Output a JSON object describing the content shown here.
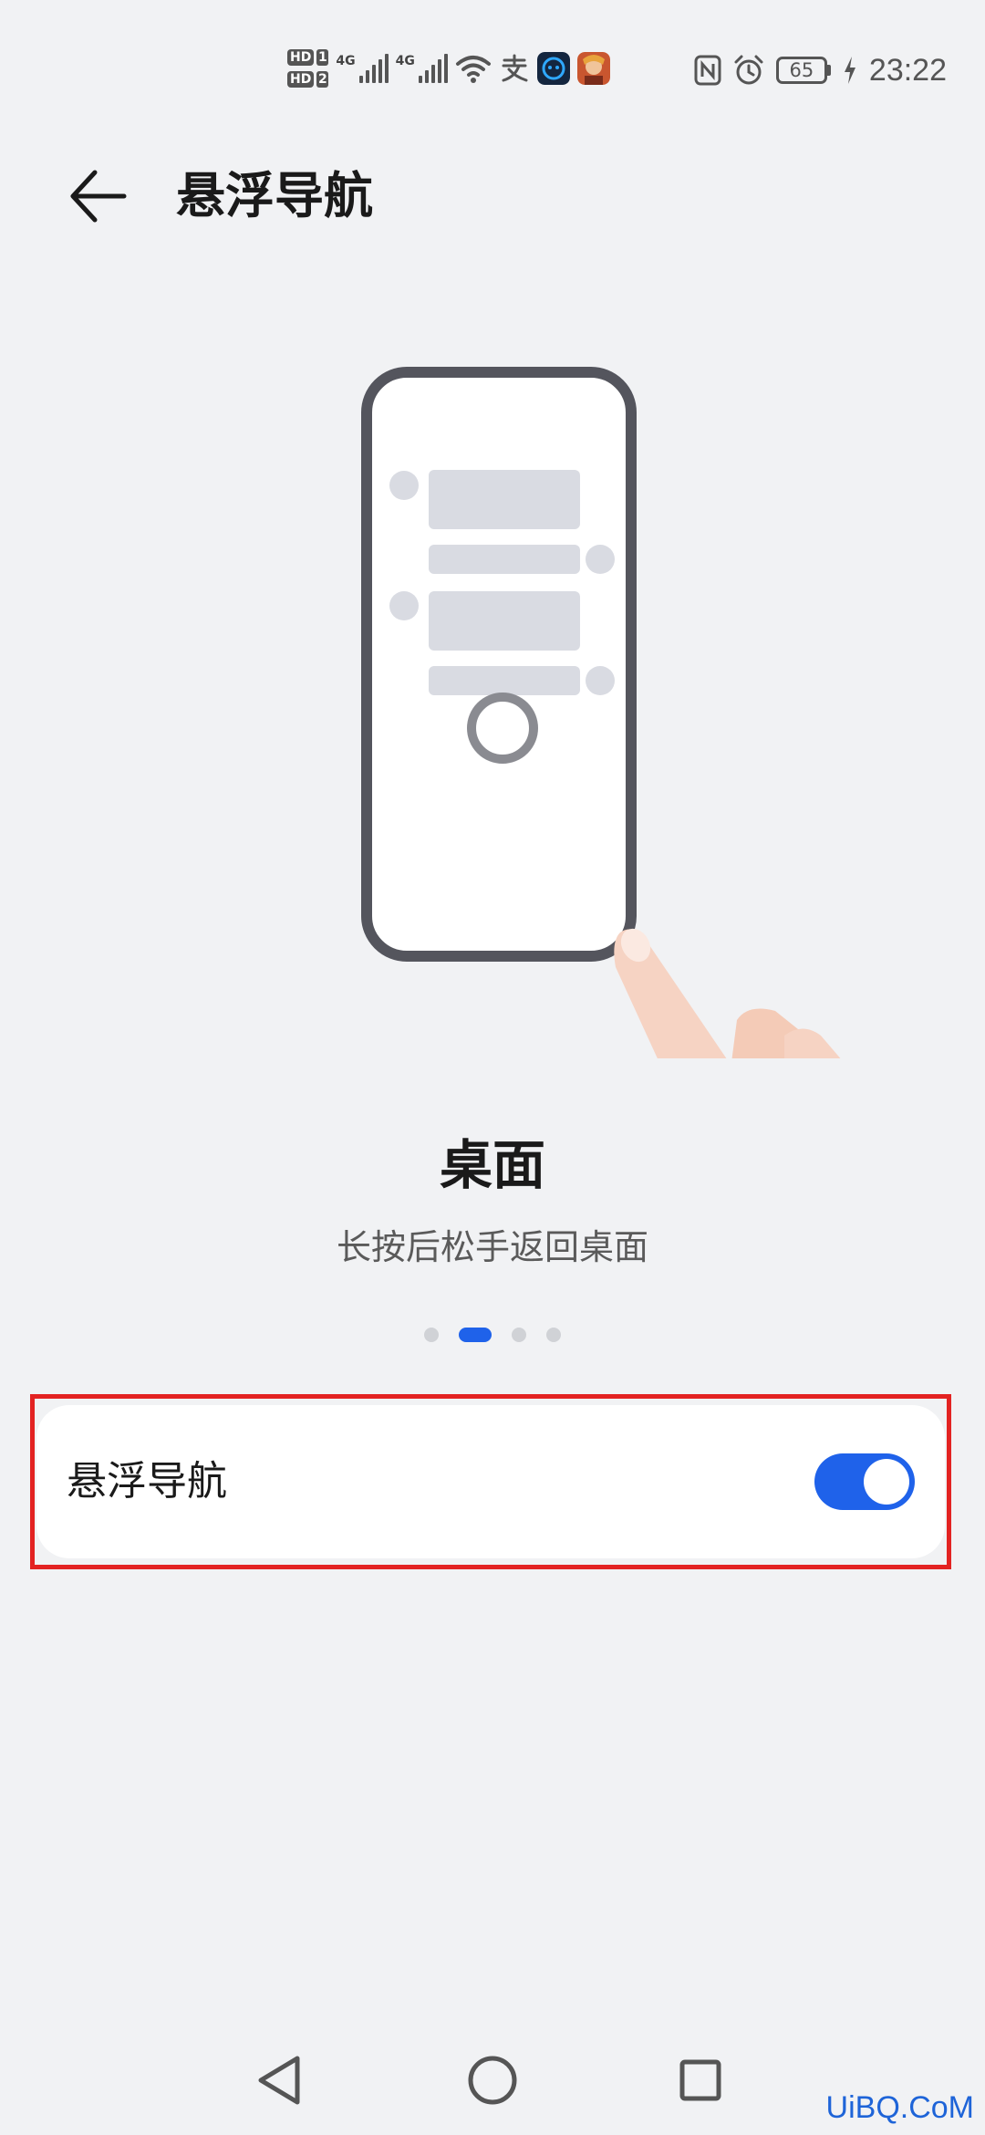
{
  "status_bar": {
    "sim1_badge": "HD",
    "sim1_num": "1",
    "sim2_badge": "HD",
    "sim2_num": "2",
    "net1": "4G",
    "net2": "4G",
    "battery": "65",
    "time": "23:22"
  },
  "header": {
    "title": "悬浮导航"
  },
  "caption": {
    "title": "桌面",
    "subtitle": "长按后松手返回桌面"
  },
  "pager": {
    "count": 4,
    "active_index": 1
  },
  "setting": {
    "label": "悬浮导航",
    "enabled": true
  },
  "colors": {
    "accent": "#1f62ea",
    "highlight": "#e32322"
  },
  "watermark": "UiBQ.CoM"
}
